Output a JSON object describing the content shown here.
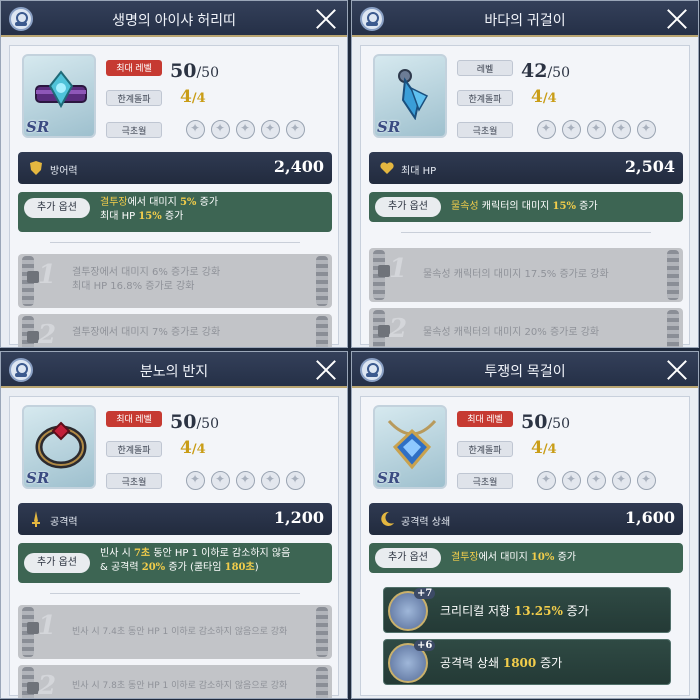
{
  "panels": [
    {
      "title": "생명의 아이샤 허리띠",
      "level_tag": "최대 레벨",
      "level": "50",
      "level_max": "/50",
      "limit_tag": "한계돌파",
      "limit": "4",
      "limit_max": "/4",
      "awaken_tag": "극초월",
      "rarity": "SR",
      "stat_label": "방어력",
      "stat_value": "2,400",
      "option_tag": "추가 옵션",
      "option_lines": [
        [
          "결투장",
          "에서 대미지 ",
          "5%",
          " 증가"
        ],
        [
          "최대 HP ",
          "15%",
          " 증가"
        ]
      ],
      "locked": [
        {
          "num": "1",
          "line1": "결투장에서 대미지 6% 증가로 강화",
          "line2": "최대 HP 16.8% 증가로 강화"
        },
        {
          "num": "2",
          "line1": "결투장에서 대미지 7% 증가로 강화",
          "line2": ""
        }
      ]
    },
    {
      "title": "바다의 귀걸이",
      "level_tag": "레벨",
      "level": "42",
      "level_max": "/50",
      "limit_tag": "한계돌파",
      "limit": "4",
      "limit_max": "/4",
      "awaken_tag": "극초월",
      "rarity": "SR",
      "stat_label": "최대 HP",
      "stat_value": "2,504",
      "option_tag": "추가 옵션",
      "option_lines": [
        [
          "물속성",
          " 캐릭터의 대미지 ",
          "15%",
          " 증가"
        ]
      ],
      "locked": [
        {
          "num": "1",
          "line1": "물속성 캐릭터의 대미지 17.5% 증가로 강화",
          "line2": ""
        },
        {
          "num": "2",
          "line1": "물속성 캐릭터의 대미지 20% 증가로 강화",
          "line2": ""
        }
      ]
    },
    {
      "title": "분노의 반지",
      "level_tag": "최대 레벨",
      "level": "50",
      "level_max": "/50",
      "limit_tag": "한계돌파",
      "limit": "4",
      "limit_max": "/4",
      "awaken_tag": "극초월",
      "rarity": "SR",
      "stat_label": "공격력",
      "stat_value": "1,200",
      "option_tag": "추가 옵션",
      "option_lines": [
        [
          "빈사 시 ",
          "7초",
          " 동안 HP 1 이하로 감소하지 않음"
        ],
        [
          "& 공격력 ",
          "20%",
          " 증가 (쿨타임 ",
          "180초",
          ")"
        ]
      ],
      "locked": [
        {
          "num": "1",
          "line1": "빈사 시 7.4초 동안 HP 1 이하로 감소하지 않음으로 강화",
          "line2": ""
        },
        {
          "num": "2",
          "line1": "빈사 시 7.8초 동안 HP 1 이하로 감소하지 않음으로 강화",
          "line2": ""
        }
      ]
    },
    {
      "title": "투쟁의 목걸이",
      "level_tag": "최대 레벨",
      "level": "50",
      "level_max": "/50",
      "limit_tag": "한계돌파",
      "limit": "4",
      "limit_max": "/4",
      "awaken_tag": "극초월",
      "rarity": "SR",
      "stat_label": "공격력 상쇄",
      "stat_value": "1,600",
      "option_tag": "추가 옵션",
      "option_lines": [
        [
          "결투장",
          "에서 대미지 ",
          "10%",
          " 증가"
        ]
      ],
      "bonuses": [
        {
          "plus": "+7",
          "label": "크리티컬 저항 ",
          "value": "13.25%",
          "suffix": " 증가"
        },
        {
          "plus": "+6",
          "label": "공격력 상쇄 ",
          "value": "1800",
          "suffix": " 증가"
        }
      ]
    }
  ],
  "colors": {
    "accent_gold": "#f2cd4b",
    "option_green": "#3d6553",
    "title_bar": "#2d3850",
    "level_red": "#c63a32"
  }
}
